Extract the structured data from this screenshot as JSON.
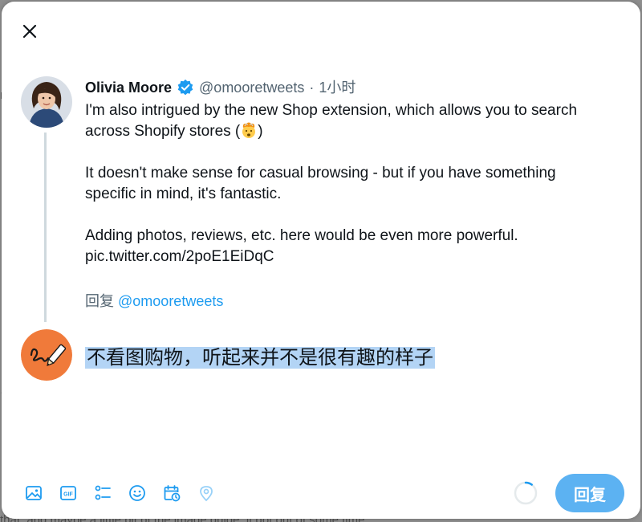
{
  "backdrop": {
    "bottom_text": "that, and maybe a little bit of the image guide, it got out of some time",
    "left_letter_1": "n",
    "left_letter_2": "·"
  },
  "modal": {
    "close_icon": "close-icon"
  },
  "tweet": {
    "author_name": "Olivia Moore",
    "verified_icon": "verified-badge-icon",
    "handle": "@omooretweets",
    "separator": "·",
    "time": "1小时",
    "body_line1": "I'm also intrigued by the new Shop extension, which allows you to search",
    "body_line2_text": "across Shopify stores (",
    "body_line2_emoji": "exploding-head-emoji",
    "body_line2_end": ")",
    "body_line3": "It doesn't make sense for casual browsing - but if you have something",
    "body_line4": "specific in mind, it's fantastic.",
    "body_line5": "Adding photos, reviews, etc. here would be even more powerful.",
    "body_line6": "pic.twitter.com/2poE1EiDqC",
    "reply_prefix": "回复",
    "reply_mention": "@omooretweets"
  },
  "composer": {
    "text": "不看图购物，听起来并不是很有趣的样子",
    "avatar_icon": "pen-scribble-avatar"
  },
  "toolbar": {
    "tools": [
      "image-icon",
      "gif-icon",
      "poll-icon",
      "emoji-icon",
      "schedule-icon",
      "location-icon"
    ],
    "reply_label": "回复",
    "progress": 0.1
  },
  "colors": {
    "accent": "#1d9bf0",
    "reply_button": "#5cb2f2",
    "selection": "#b3d4f5",
    "avatar_orange": "#f07a3a"
  }
}
